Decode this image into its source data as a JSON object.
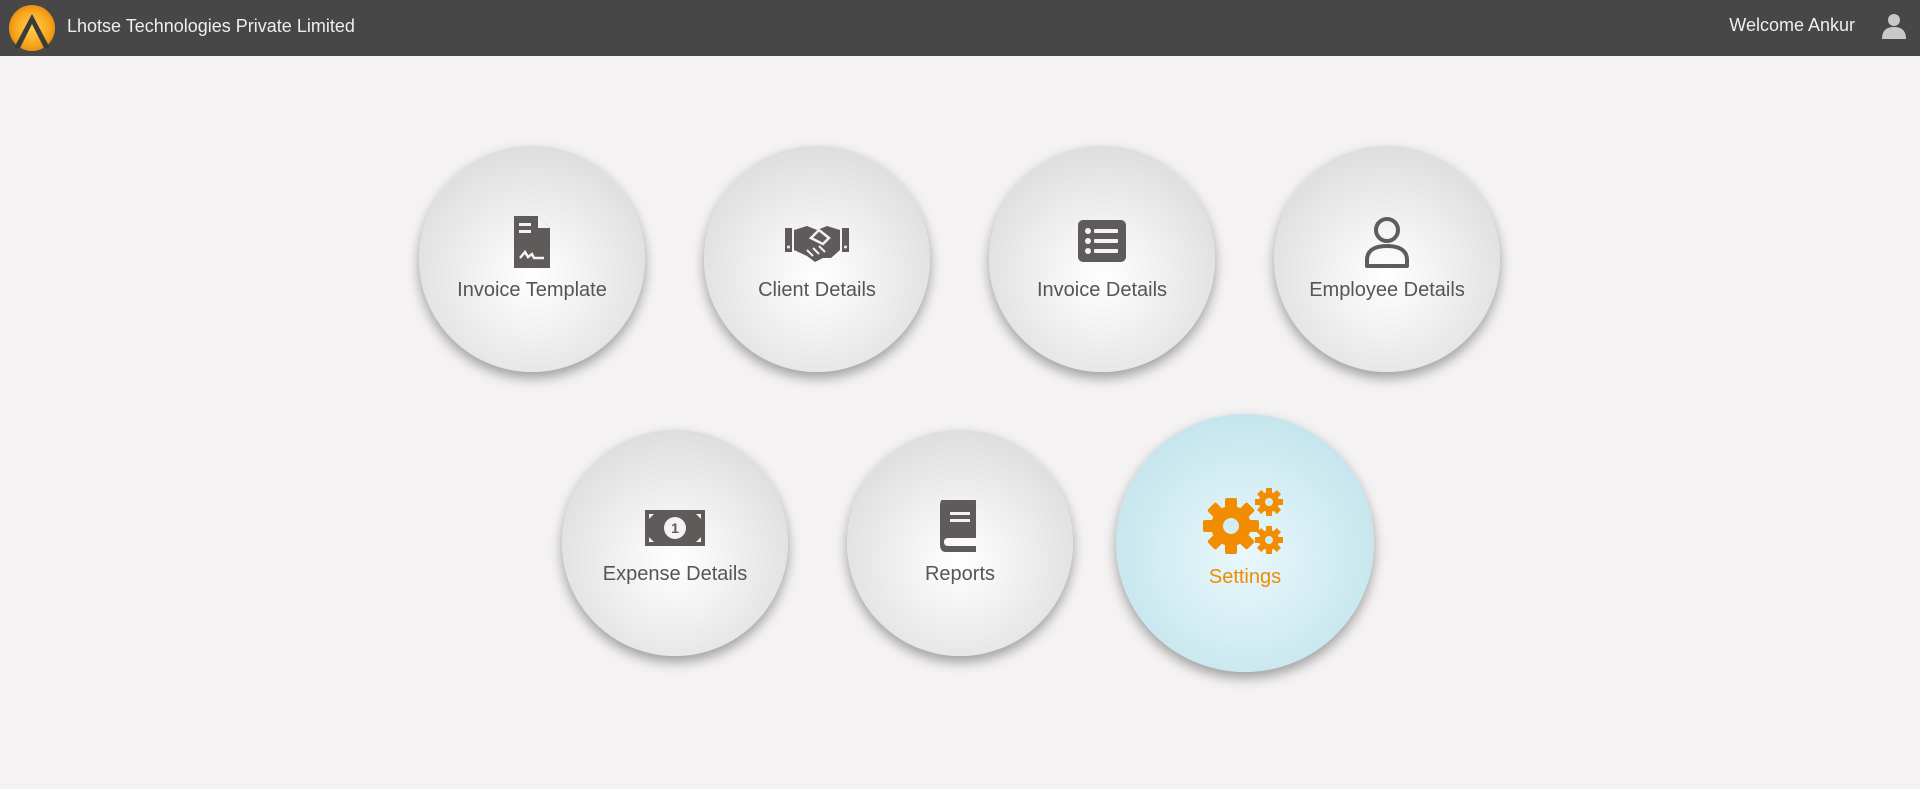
{
  "header": {
    "company_name": "Lhotse Technologies Private Limited",
    "welcome_text": "Welcome Ankur"
  },
  "tiles": [
    {
      "label": "Invoice Template",
      "icon": "invoice-template-icon"
    },
    {
      "label": "Client Details",
      "icon": "handshake-icon"
    },
    {
      "label": "Invoice Details",
      "icon": "list-icon"
    },
    {
      "label": "Employee Details",
      "icon": "user-icon"
    },
    {
      "label": "Expense Details",
      "icon": "money-bill-icon"
    },
    {
      "label": "Reports",
      "icon": "book-icon"
    },
    {
      "label": "Settings",
      "icon": "gears-icon",
      "active": true
    }
  ],
  "colors": {
    "header_bg": "#474747",
    "page_bg": "#f4f2f2",
    "icon": "#5f5b5b",
    "accent": "#f08c00",
    "active_tile": "#cfeaf1"
  }
}
